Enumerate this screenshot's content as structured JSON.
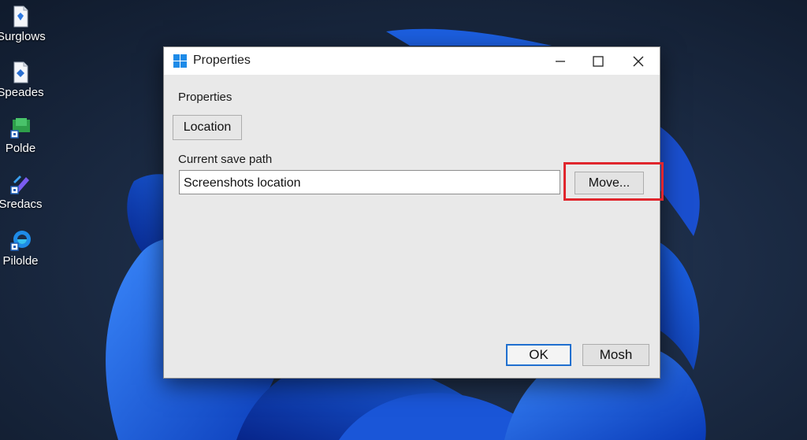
{
  "desktop": {
    "icons": [
      {
        "label": "Surglows",
        "icon": "document-icon"
      },
      {
        "label": "Speades",
        "icon": "document-icon"
      },
      {
        "label": "Polde",
        "icon": "monitor-icon"
      },
      {
        "label": "Sredacs",
        "icon": "pen-icon"
      },
      {
        "label": "Pilolde",
        "icon": "edge-icon"
      }
    ]
  },
  "dialog": {
    "title": "Properties",
    "icon": "windows-logo-icon",
    "heading": "Properties",
    "tab_label": "Location",
    "path_label": "Current save path",
    "path_value": "Screenshots location",
    "move_label": "Move...",
    "ok_label": "OK",
    "mosh_label": "Mosh",
    "highlight_color": "#e0262d",
    "accent_color": "#1e8be8"
  }
}
